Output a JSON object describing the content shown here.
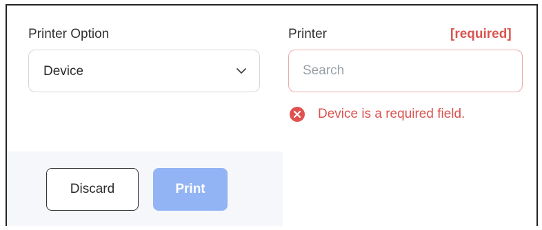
{
  "printer_option": {
    "label": "Printer Option",
    "selected": "Device",
    "chevron_icon": "chevron-down-icon"
  },
  "printer": {
    "label": "Printer",
    "required_tag": "[required]",
    "placeholder": "Search",
    "value": "",
    "error_icon": "error-circle-x-icon",
    "error_message": "Device is a required field."
  },
  "actions": {
    "discard_label": "Discard",
    "print_label": "Print"
  },
  "colors": {
    "error": "#d9534f",
    "error_border": "#f0a7a7",
    "primary_disabled": "#93b4f4",
    "footer_bg": "#f5f7fa"
  }
}
